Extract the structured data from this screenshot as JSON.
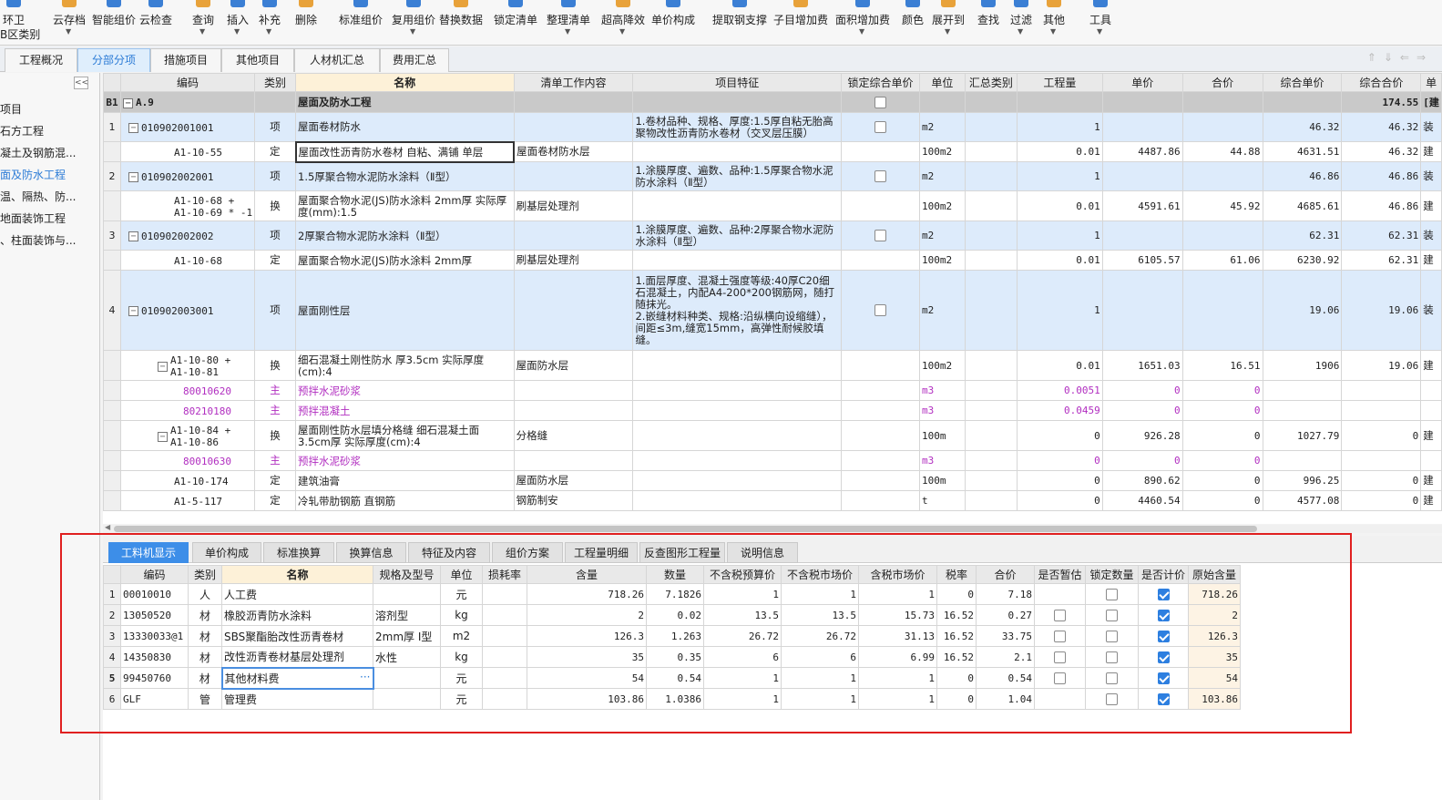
{
  "toolbar": {
    "items": [
      {
        "label": "环卫",
        "sub": "B区类别"
      },
      {
        "label": "云存档"
      },
      {
        "label": "智能组价"
      },
      {
        "label": "云检查"
      },
      {
        "label": "查询"
      },
      {
        "label": "插入"
      },
      {
        "label": "补充"
      },
      {
        "label": "删除"
      },
      {
        "label": "标准组价"
      },
      {
        "label": "复用组价"
      },
      {
        "label": "替换数据"
      },
      {
        "label": "锁定清单"
      },
      {
        "label": "整理清单"
      },
      {
        "label": "超高降效"
      },
      {
        "label": "单价构成"
      },
      {
        "label": "提取钢支撑"
      },
      {
        "label": "子目增加费"
      },
      {
        "label": "面积增加费"
      },
      {
        "label": "颜色"
      },
      {
        "label": "展开到"
      },
      {
        "label": "查找"
      },
      {
        "label": "过滤"
      },
      {
        "label": "其他"
      },
      {
        "label": "工具"
      }
    ]
  },
  "tabs": [
    "工程概况",
    "分部分项",
    "措施项目",
    "其他项目",
    "人材机汇总",
    "费用汇总"
  ],
  "active_tab": "分部分项",
  "sidebar": {
    "items": [
      "项目",
      "石方工程",
      "凝土及钢筋混...",
      "面及防水工程",
      "温、隔热、防...",
      "地面装饰工程",
      "、柱面装饰与..."
    ],
    "selected": "面及防水工程"
  },
  "grid": {
    "headers": [
      "",
      "编码",
      "类别",
      "名称",
      "清单工作内容",
      "项目特征",
      "锁定综合单价",
      "单位",
      "汇总类别",
      "工程量",
      "单价",
      "合价",
      "综合单价",
      "综合合价",
      "单"
    ],
    "b1": {
      "idx": "B1",
      "code": "A.9",
      "name": "屋面及防水工程",
      "total": "174.55",
      "suffix": "[建"
    },
    "rows": [
      {
        "idx": "1",
        "type": "xiang",
        "code": "010902001001",
        "cat": "项",
        "name": "屋面卷材防水",
        "work": "",
        "feature": "1.卷材品种、规格、厚度:1.5厚自粘无胎高聚物改性沥青防水卷材（交叉层压膜）",
        "lock": "box",
        "unit": "m2",
        "qty": "1",
        "price": "",
        "amt": "",
        "unitp": "46.32",
        "total": "46.32",
        "last": "装"
      },
      {
        "idx": "",
        "type": "ding",
        "code": "A1-10-55",
        "cat": "定",
        "name": "屋面改性沥青防水卷材 自粘、满铺 单层",
        "work": "屋面卷材防水层",
        "feature": "",
        "unit": "100m2",
        "qty": "0.01",
        "price": "4487.86",
        "amt": "44.88",
        "unitp": "4631.51",
        "total": "46.32",
        "last": "建"
      },
      {
        "idx": "2",
        "type": "xiang",
        "code": "010902002001",
        "cat": "项",
        "name": "1.5厚聚合物水泥防水涂料（Ⅱ型）",
        "work": "",
        "feature": "1.涂膜厚度、遍数、品种:1.5厚聚合物水泥防水涂料（Ⅱ型）",
        "lock": "box",
        "unit": "m2",
        "qty": "1",
        "price": "",
        "amt": "",
        "unitp": "46.86",
        "total": "46.86",
        "last": "装"
      },
      {
        "idx": "",
        "type": "ding",
        "code": "A1-10-68 +\nA1-10-69 * -1",
        "cat": "换",
        "name": "屋面聚合物水泥(JS)防水涂料 2mm厚  实际厚度(mm):1.5",
        "work": "刷基层处理剂",
        "feature": "",
        "unit": "100m2",
        "qty": "0.01",
        "price": "4591.61",
        "amt": "45.92",
        "unitp": "4685.61",
        "total": "46.86",
        "last": "建"
      },
      {
        "idx": "3",
        "type": "xiang",
        "code": "010902002002",
        "cat": "项",
        "name": "2厚聚合物水泥防水涂料（Ⅱ型）",
        "work": "",
        "feature": "1.涂膜厚度、遍数、品种:2厚聚合物水泥防水涂料（Ⅱ型）",
        "lock": "box",
        "unit": "m2",
        "qty": "1",
        "price": "",
        "amt": "",
        "unitp": "62.31",
        "total": "62.31",
        "last": "装"
      },
      {
        "idx": "",
        "type": "ding",
        "code": "A1-10-68",
        "cat": "定",
        "name": "屋面聚合物水泥(JS)防水涂料 2mm厚",
        "work": "刷基层处理剂",
        "feature": "",
        "unit": "100m2",
        "qty": "0.01",
        "price": "6105.57",
        "amt": "61.06",
        "unitp": "6230.92",
        "total": "62.31",
        "last": "建"
      },
      {
        "idx": "4",
        "type": "xiang",
        "code": "010902003001",
        "cat": "项",
        "name": "屋面刚性层",
        "work": "",
        "feature": "1.面层厚度、混凝土强度等级:40厚C20细石混凝土，内配A4-200*200钢筋网，随打随抹光。\n2.嵌缝材料种类、规格:沿纵横向设缩缝），间距≤3m,缝宽15mm，高弹性耐候胶填缝。",
        "lock": "box",
        "unit": "m2",
        "qty": "1",
        "price": "",
        "amt": "",
        "unitp": "19.06",
        "total": "19.06",
        "last": "装"
      },
      {
        "idx": "",
        "type": "ding2",
        "code": "A1-10-80 +\nA1-10-81",
        "cat": "换",
        "name": "细石混凝土刚性防水 厚3.5cm  实际厚度(cm):4",
        "work": "屋面防水层",
        "feature": "",
        "unit": "100m2",
        "qty": "0.01",
        "price": "1651.03",
        "amt": "16.51",
        "unitp": "1906",
        "total": "19.06",
        "last": "建"
      },
      {
        "idx": "",
        "type": "zhu",
        "code": "80010620",
        "cat": "主",
        "name": "预拌水泥砂浆",
        "work": "",
        "feature": "",
        "unit": "m3",
        "qty": "0.0051",
        "price": "0",
        "amt": "0",
        "unitp": "",
        "total": "",
        "last": ""
      },
      {
        "idx": "",
        "type": "zhu",
        "code": "80210180",
        "cat": "主",
        "name": "预拌混凝土",
        "work": "",
        "feature": "",
        "unit": "m3",
        "qty": "0.0459",
        "price": "0",
        "amt": "0",
        "unitp": "",
        "total": "",
        "last": ""
      },
      {
        "idx": "",
        "type": "ding2",
        "code": "A1-10-84 +\nA1-10-86",
        "cat": "换",
        "name": "屋面刚性防水层填分格缝 细石混凝土面3.5cm厚  实际厚度(cm):4",
        "work": "分格缝",
        "feature": "",
        "unit": "100m",
        "qty": "0",
        "price": "926.28",
        "amt": "0",
        "unitp": "1027.79",
        "total": "0",
        "last": "建"
      },
      {
        "idx": "",
        "type": "zhu",
        "code": "80010630",
        "cat": "主",
        "name": "预拌水泥砂浆",
        "work": "",
        "feature": "",
        "unit": "m3",
        "qty": "0",
        "price": "0",
        "amt": "0",
        "unitp": "",
        "total": "",
        "last": ""
      },
      {
        "idx": "",
        "type": "ding",
        "code": "A1-10-174",
        "cat": "定",
        "name": "建筑油膏",
        "work": "屋面防水层",
        "feature": "",
        "unit": "100m",
        "qty": "0",
        "price": "890.62",
        "amt": "0",
        "unitp": "996.25",
        "total": "0",
        "last": "建"
      },
      {
        "idx": "",
        "type": "ding",
        "code": "A1-5-117",
        "cat": "定",
        "name": "冷轧带肋钢筋 直钢筋",
        "work": "钢筋制安",
        "feature": "",
        "unit": "t",
        "qty": "0",
        "price": "4460.54",
        "amt": "0",
        "unitp": "4577.08",
        "total": "0",
        "last": "建"
      }
    ]
  },
  "bottom": {
    "tabs": [
      "工料机显示",
      "单价构成",
      "标准换算",
      "换算信息",
      "特征及内容",
      "组价方案",
      "工程量明细",
      "反查图形工程量",
      "说明信息"
    ],
    "active_tab": "工料机显示",
    "headers": [
      "",
      "编码",
      "类别",
      "名称",
      "规格及型号",
      "单位",
      "损耗率",
      "含量",
      "数量",
      "不含税预算价",
      "不含税市场价",
      "含税市场价",
      "税率",
      "合价",
      "是否暂估",
      "锁定数量",
      "是否计价",
      "原始含量"
    ],
    "rows": [
      {
        "idx": "1",
        "code": "00010010",
        "cat": "人",
        "name": "人工费",
        "spec": "",
        "unit": "元",
        "loss": "",
        "content": "718.26",
        "qty": "7.1826",
        "budget": "1",
        "market": "1",
        "taxm": "1",
        "rate": "0",
        "amt": "7.18",
        "est": "",
        "lockq": "off",
        "price": "on",
        "orig": "718.26"
      },
      {
        "idx": "2",
        "code": "13050520",
        "cat": "材",
        "name": "橡胶沥青防水涂料",
        "spec": "溶剂型",
        "unit": "kg",
        "loss": "",
        "content": "2",
        "qty": "0.02",
        "budget": "13.5",
        "market": "13.5",
        "taxm": "15.73",
        "rate": "16.52",
        "amt": "0.27",
        "est": "off",
        "lockq": "off",
        "price": "on",
        "orig": "2"
      },
      {
        "idx": "3",
        "code": "13330033@1",
        "cat": "材",
        "name": "SBS聚酯胎改性沥青卷材",
        "spec": "2mm厚 I型",
        "unit": "m2",
        "loss": "",
        "content": "126.3",
        "qty": "1.263",
        "budget": "26.72",
        "market": "26.72",
        "taxm": "31.13",
        "rate": "16.52",
        "amt": "33.75",
        "est": "off",
        "lockq": "off",
        "price": "on",
        "orig": "126.3"
      },
      {
        "idx": "4",
        "code": "14350830",
        "cat": "材",
        "name": "改性沥青卷材基层处理剂",
        "spec": "水性",
        "unit": "kg",
        "loss": "",
        "content": "35",
        "qty": "0.35",
        "budget": "6",
        "market": "6",
        "taxm": "6.99",
        "rate": "16.52",
        "amt": "2.1",
        "est": "off",
        "lockq": "off",
        "price": "on",
        "orig": "35"
      },
      {
        "idx": "5",
        "code": "99450760",
        "cat": "材",
        "name": "其他材料费",
        "spec": "",
        "unit": "元",
        "loss": "",
        "content": "54",
        "qty": "0.54",
        "budget": "1",
        "market": "1",
        "taxm": "1",
        "rate": "0",
        "amt": "0.54",
        "est": "off",
        "lockq": "off",
        "price": "on",
        "orig": "54"
      },
      {
        "idx": "6",
        "code": "GLF",
        "cat": "管",
        "name": "管理费",
        "spec": "",
        "unit": "元",
        "loss": "",
        "content": "103.86",
        "qty": "1.0386",
        "budget": "1",
        "market": "1",
        "taxm": "1",
        "rate": "0",
        "amt": "1.04",
        "est": "",
        "lockq": "off",
        "price": "on",
        "orig": "103.86"
      }
    ],
    "selected_row": "5",
    "ellipsis": "···"
  },
  "colors": {
    "accent": "#2b7bd6",
    "highlight": "#e02020",
    "zhu_text": "#b12ec0",
    "xiang_bg": "#ddebfb"
  }
}
